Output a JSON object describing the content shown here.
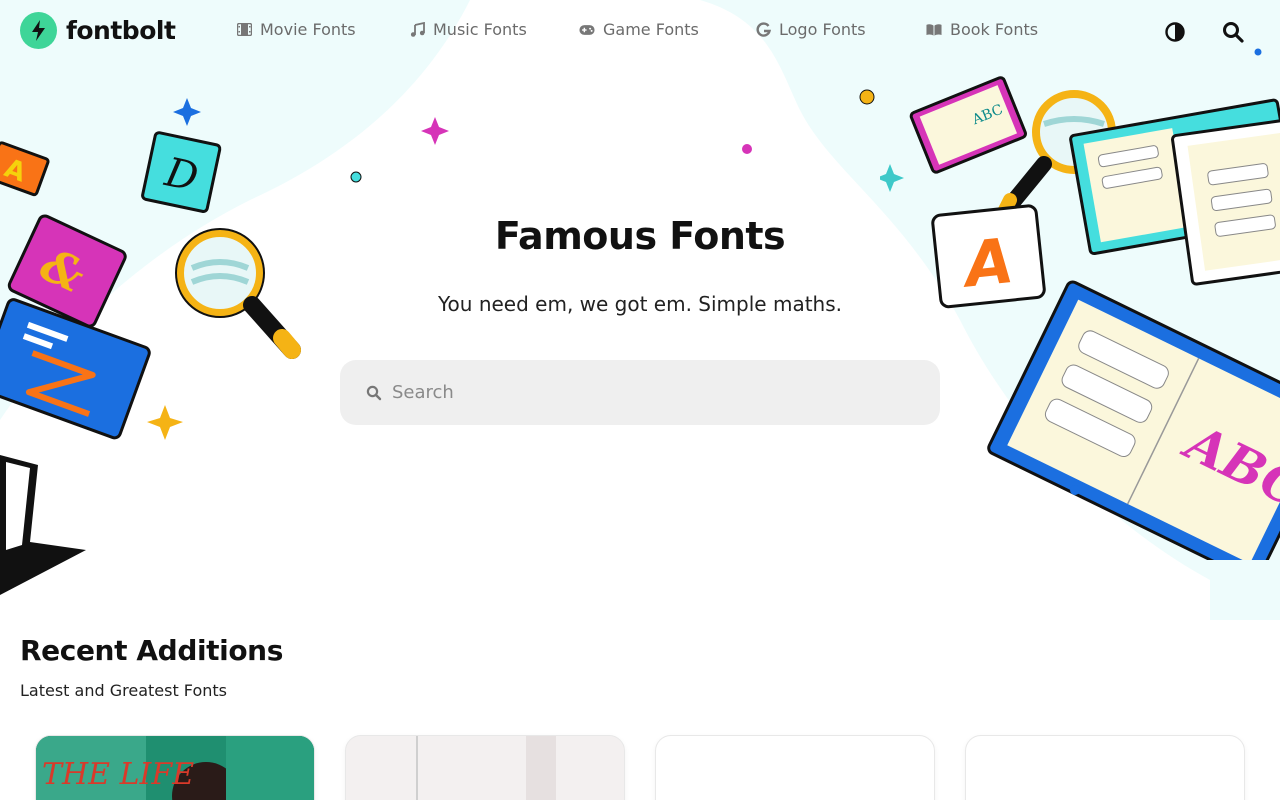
{
  "header": {
    "logo_text": "fontbolt",
    "nav": [
      {
        "label": "Movie Fonts",
        "icon": "film-icon"
      },
      {
        "label": "Music Fonts",
        "icon": "music-note-icon"
      },
      {
        "label": "Game Fonts",
        "icon": "gamepad-icon"
      },
      {
        "label": "Logo Fonts",
        "icon": "g-letter-icon"
      },
      {
        "label": "Book Fonts",
        "icon": "book-open-icon"
      }
    ],
    "theme_toggle_icon": "contrast-icon",
    "search_icon": "search-icon"
  },
  "hero": {
    "title": "Famous Fonts",
    "subtitle": "You need em, we got em. Simple maths.",
    "search_placeholder": "Search"
  },
  "recent": {
    "title": "Recent Additions",
    "subtitle": "Latest and Greatest Fonts",
    "card1_text": "THE LIFE"
  },
  "colors": {
    "brand_green": "#3ed598",
    "bg_blob": "#ecfbfb",
    "pink": "#d634b8",
    "blue": "#1b6fe0",
    "yellow": "#f5b315",
    "teal": "#3ed6d6"
  }
}
